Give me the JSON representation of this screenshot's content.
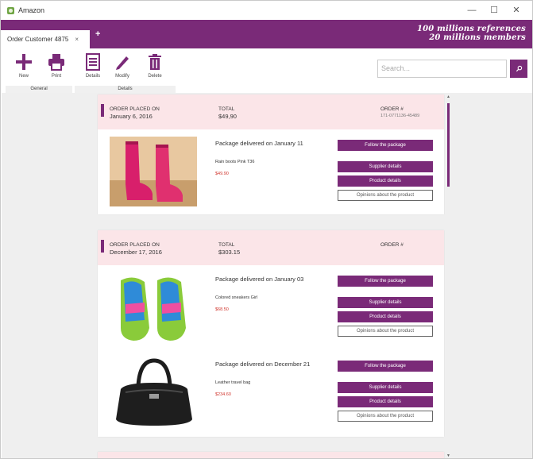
{
  "window": {
    "title": "Amazon",
    "controls": [
      "—",
      "☐",
      "✕"
    ]
  },
  "tabs": [
    {
      "label": "Order Customer 4875",
      "close": "×"
    }
  ],
  "tab_add": "+",
  "brand": {
    "line1": "100 millions references",
    "line2": "20 millions members"
  },
  "ribbon": {
    "buttons": [
      {
        "label": "New",
        "icon": "plus-icon"
      },
      {
        "label": "Print",
        "icon": "printer-icon"
      },
      {
        "label": "Details",
        "icon": "document-icon"
      },
      {
        "label": "Modify",
        "icon": "pencil-icon"
      },
      {
        "label": "Delete",
        "icon": "trash-icon"
      }
    ],
    "groups": [
      "General",
      "Details"
    ]
  },
  "search": {
    "placeholder": "Search...",
    "icon": "search-icon"
  },
  "colors": {
    "accent": "#7a2a78",
    "header_bg": "#fbe5e8",
    "price": "#d0342c"
  },
  "orders": [
    {
      "placed_label": "ORDER PLACED ON",
      "placed_date": "January 6, 2016",
      "total_label": "TOTAL",
      "total": "$49,90",
      "order_label": "ORDER #",
      "order_number": "171-0771136-45489",
      "items": [
        {
          "status": "Package delivered on January 11",
          "name": "Rain boots Pink T36",
          "price": "$49.90",
          "image": "pink-rain-boots",
          "buttons": {
            "follow": "Follow the package",
            "supplier": "Supplier details",
            "product": "Product details",
            "opinions": "Opinions about the product"
          }
        }
      ]
    },
    {
      "placed_label": "ORDER PLACED ON",
      "placed_date": "December 17, 2016",
      "total_label": "TOTAL",
      "total": "$303.15",
      "order_label": "ORDER #",
      "order_number": "",
      "items": [
        {
          "status": "Package delivered on January 03",
          "name": "Colored sneakers Girl",
          "price": "$68.50",
          "image": "colored-sneakers",
          "buttons": {
            "follow": "Follow the package",
            "supplier": "Supplier details",
            "product": "Product details",
            "opinions": "Opinions about the product"
          }
        },
        {
          "status": "Package delivered on December 21",
          "name": "Leather travel bag",
          "price": "$234.60",
          "image": "leather-handbag",
          "buttons": {
            "follow": "Follow the package",
            "supplier": "Supplier details",
            "product": "Product details",
            "opinions": "Opinions about the product"
          }
        }
      ]
    }
  ]
}
